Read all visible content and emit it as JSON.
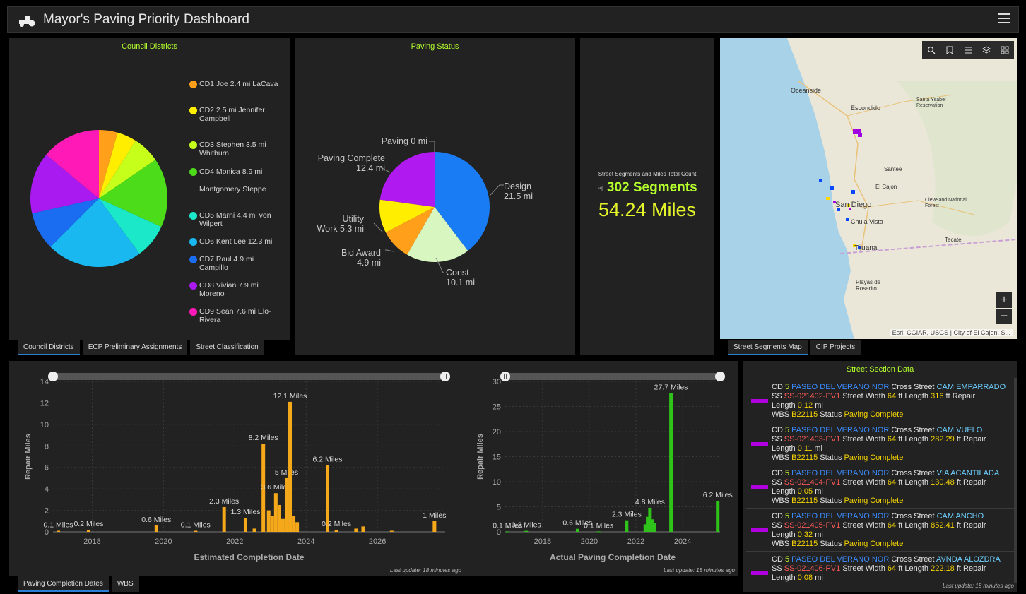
{
  "header": {
    "title": "Mayor's Paving Priority Dashboard"
  },
  "council": {
    "title": "Council Districts",
    "legend": [
      {
        "label": "CD1 Joe 2.4 mi LaCava",
        "color": "#ff9f1a"
      },
      {
        "label": "CD2 2.5 mi Jennifer Campbell",
        "color": "#ffee00"
      },
      {
        "label": "CD3 Stephen 3.5 mi Whitburn",
        "color": "#c6ff1a"
      },
      {
        "label": "CD4 Monica 8.9 mi",
        "color": "#4ddc1a"
      },
      {
        "label": "Montgomery Steppe",
        "color": ""
      },
      {
        "label": "CD5 Marni 4.4 mi von Wilpert",
        "color": "#1ae8c8"
      },
      {
        "label": "CD6 Kent Lee 12.3 mi",
        "color": "#1ab8f0"
      },
      {
        "label": "CD7 Raul 4.9 mi Campillo",
        "color": "#1a6cf0"
      },
      {
        "label": "CD8 Vivian 7.9 mi Moreno",
        "color": "#a81af0"
      },
      {
        "label": "CD9 Sean 7.6 mi Elo-Rivera",
        "color": "#ff1ab8"
      }
    ],
    "tabs": [
      "Council Districts",
      "ECP Preliminary Assignments",
      "Street Classification"
    ]
  },
  "paving_status": {
    "title": "Paving Status",
    "slices": [
      {
        "label": "Design 21.5 mi",
        "value": 21.5,
        "color": "#1a7cf5"
      },
      {
        "label": "Const 10.1 mi",
        "value": 10.1,
        "color": "#d8f7c0"
      },
      {
        "label": "Bid Award 4.9 mi",
        "value": 4.9,
        "color": "#ff9f1a"
      },
      {
        "label": "Utility Work 5.3 mi",
        "value": 5.3,
        "color": "#ffee00"
      },
      {
        "label": "Paving Complete 12.4 mi",
        "value": 12.4,
        "color": "#b01af0"
      },
      {
        "label": "Paving 0 mi",
        "value": 0,
        "color": "#ff1ab8"
      }
    ]
  },
  "counts": {
    "caption": "Street Segments and Miles Total Count",
    "segments": "302 Segments",
    "miles": "54.24 Miles"
  },
  "map": {
    "labels": [
      "Oceanside",
      "Escondido",
      "Santee",
      "El Cajon",
      "San Diego",
      "Chula Vista",
      "Tijuana",
      "Tecate",
      "Cleveland National Forest",
      "Santa Ysabel Reservation",
      "Playas de Rosarito"
    ],
    "attribution": "Esri, CGIAR, USGS | City of El Cajon, S...",
    "tabs": [
      "Street Segments Map",
      "CIP Projects"
    ]
  },
  "est_chart": {
    "xlabel": "Estimated Completion Date",
    "ylabel": "Repair Miles",
    "update": "Last update: 18 minutes ago",
    "tabs": [
      "Paving Completion Dates",
      "WBS"
    ]
  },
  "act_chart": {
    "xlabel": "Actual Paving Completion Date",
    "ylabel": "Repair Miles",
    "update": "Last update: 18 minutes ago"
  },
  "chart_data": [
    {
      "type": "bar",
      "xlabel": "Estimated Completion Date",
      "ylabel": "Repair Miles",
      "ylim": [
        0,
        14
      ],
      "xlim": [
        2016.9,
        2027.9
      ],
      "yticks": [
        0,
        2,
        4,
        6,
        8,
        10,
        12,
        14
      ],
      "xticks": [
        2018,
        2020,
        2022,
        2024,
        2026
      ],
      "color": "#f5a91a",
      "bars": [
        {
          "x": 2017.05,
          "y": 0.1,
          "label": "0.1 Miles"
        },
        {
          "x": 2017.9,
          "y": 0.2,
          "label": "0.2 Miles"
        },
        {
          "x": 2019.8,
          "y": 0.6,
          "label": "0.6 Miles"
        },
        {
          "x": 2020.9,
          "y": 0.1,
          "label": "0.1 Miles"
        },
        {
          "x": 2021.7,
          "y": 2.3,
          "label": "2.3 Miles"
        },
        {
          "x": 2022.3,
          "y": 1.3,
          "label": "1.3 Miles"
        },
        {
          "x": 2022.55,
          "y": 0.3,
          "label": ""
        },
        {
          "x": 2022.8,
          "y": 8.2,
          "label": "8.2 Miles"
        },
        {
          "x": 2022.95,
          "y": 2.0,
          "label": ""
        },
        {
          "x": 2023.05,
          "y": 1.5,
          "label": ""
        },
        {
          "x": 2023.15,
          "y": 3.6,
          "label": "3.6 Miles"
        },
        {
          "x": 2023.25,
          "y": 2.5,
          "label": ""
        },
        {
          "x": 2023.35,
          "y": 1.2,
          "label": ""
        },
        {
          "x": 2023.45,
          "y": 5.0,
          "label": "5 Miles"
        },
        {
          "x": 2023.55,
          "y": 12.1,
          "label": "12.1 Miles"
        },
        {
          "x": 2023.65,
          "y": 1.5,
          "label": ""
        },
        {
          "x": 2023.75,
          "y": 0.9,
          "label": ""
        },
        {
          "x": 2024.6,
          "y": 6.2,
          "label": "6.2 Miles"
        },
        {
          "x": 2024.85,
          "y": 0.2,
          "label": "0.2 Miles"
        },
        {
          "x": 2025.4,
          "y": 0.3,
          "label": ""
        },
        {
          "x": 2025.6,
          "y": 0.5,
          "label": ""
        },
        {
          "x": 2026.4,
          "y": 0.1,
          "label": ""
        },
        {
          "x": 2027.6,
          "y": 1.0,
          "label": "1 Miles"
        }
      ]
    },
    {
      "type": "bar",
      "xlabel": "Actual Paving Completion Date",
      "ylabel": "Repair Miles",
      "ylim": [
        0,
        30
      ],
      "xlim": [
        2016.4,
        2025.6
      ],
      "yticks": [
        0,
        5,
        10,
        15,
        20,
        25,
        30
      ],
      "xticks": [
        2018,
        2020,
        2022,
        2024
      ],
      "color": "#2ec21a",
      "bars": [
        {
          "x": 2016.5,
          "y": 0.1,
          "label": "0.1 Miles"
        },
        {
          "x": 2017.3,
          "y": 0.2,
          "label": "0.2 Miles"
        },
        {
          "x": 2019.5,
          "y": 0.6,
          "label": "0.6 Miles"
        },
        {
          "x": 2020.4,
          "y": 0.1,
          "label": "0.1 Miles"
        },
        {
          "x": 2021.6,
          "y": 2.3,
          "label": "2.3 Miles"
        },
        {
          "x": 2022.4,
          "y": 1.5,
          "label": ""
        },
        {
          "x": 2022.5,
          "y": 3.0,
          "label": ""
        },
        {
          "x": 2022.6,
          "y": 4.8,
          "label": "4.8 Miles"
        },
        {
          "x": 2022.7,
          "y": 2.5,
          "label": ""
        },
        {
          "x": 2022.8,
          "y": 1.8,
          "label": ""
        },
        {
          "x": 2023.5,
          "y": 27.7,
          "label": "27.7 Miles"
        },
        {
          "x": 2025.5,
          "y": 6.2,
          "label": "6.2 Miles"
        }
      ]
    }
  ],
  "street_section": {
    "title": "Street Section Data",
    "update": "Last update: 18 minutes ago",
    "items": [
      {
        "cd": "5",
        "street": "PASEO DEL VERANO NOR",
        "cross": "CAM EMPARRADO",
        "ss": "SS-021402-PV1",
        "width": "64",
        "length": "316",
        "repair": "0.12",
        "wbs": "B22115",
        "status": "Paving Complete"
      },
      {
        "cd": "5",
        "street": "PASEO DEL VERANO NOR",
        "cross": "CAM VUELO",
        "ss": "SS-021403-PV1",
        "width": "64",
        "length": "282.29",
        "repair": "0.11",
        "wbs": "B22115",
        "status": "Paving Complete"
      },
      {
        "cd": "5",
        "street": "PASEO DEL VERANO NOR",
        "cross": "VIA ACANTILADA",
        "ss": "SS-021404-PV1",
        "width": "64",
        "length": "130.48",
        "repair": "0.05",
        "wbs": "B22115",
        "status": "Paving Complete"
      },
      {
        "cd": "5",
        "street": "PASEO DEL VERANO NOR",
        "cross": "CAM ANCHO",
        "ss": "SS-021405-PV1",
        "width": "64",
        "length": "852.41",
        "repair": "0.32",
        "wbs": "B22115",
        "status": "Paving Complete"
      },
      {
        "cd": "5",
        "street": "PASEO DEL VERANO NOR",
        "cross": "AVNDA ALOZDRA",
        "ss": "SS-021406-PV1",
        "width": "64",
        "length": "222.18",
        "repair": "0.08",
        "wbs": "",
        "status": ""
      }
    ]
  },
  "text": {
    "cd_prefix": "CD",
    "cross_prefix": "Cross Street",
    "ss_prefix": "SS",
    "width_prefix": "Street Width",
    "length_prefix": "Length",
    "ft": "ft",
    "repair": "Repair",
    "length2": "Length",
    "mi": "mi",
    "wbs_prefix": "WBS",
    "status_prefix": "Status"
  }
}
